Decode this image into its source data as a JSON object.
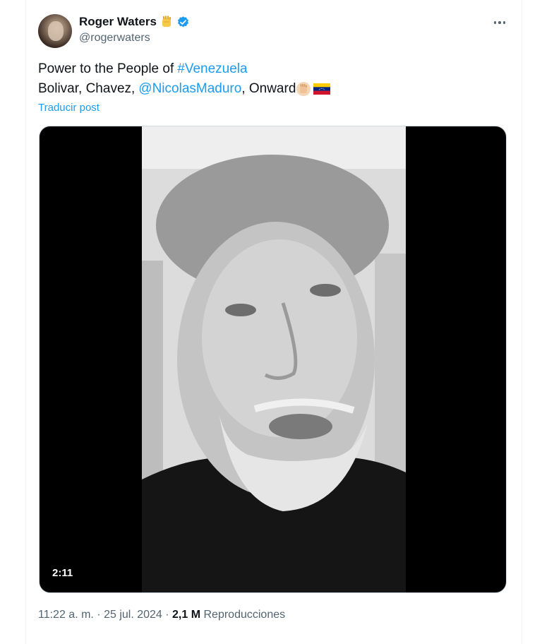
{
  "author": {
    "name": "Roger Waters",
    "handle": "@rogerwaters"
  },
  "post": {
    "line1_prefix": "Power to the People of ",
    "line1_hashtag": "#Venezuela",
    "line2_prefix": "Bolivar, Chavez, ",
    "line2_mention": "@NicolasMaduro",
    "line2_suffix": ", Onward",
    "translate_label": "Traducir post"
  },
  "media": {
    "duration": "2:11"
  },
  "meta": {
    "time": "11:22 a. m.",
    "separator": " · ",
    "date": "25 jul. 2024",
    "views_count": "2,1 M",
    "views_label": "Reproducciones"
  },
  "colors": {
    "link": "#1d9bf0",
    "verified": "#1d9bf0",
    "secondary_text": "#536471"
  },
  "icons": [
    "raised-fist-emoji",
    "verified-badge-icon",
    "more-options-icon",
    "venezuela-flag-emoji"
  ]
}
